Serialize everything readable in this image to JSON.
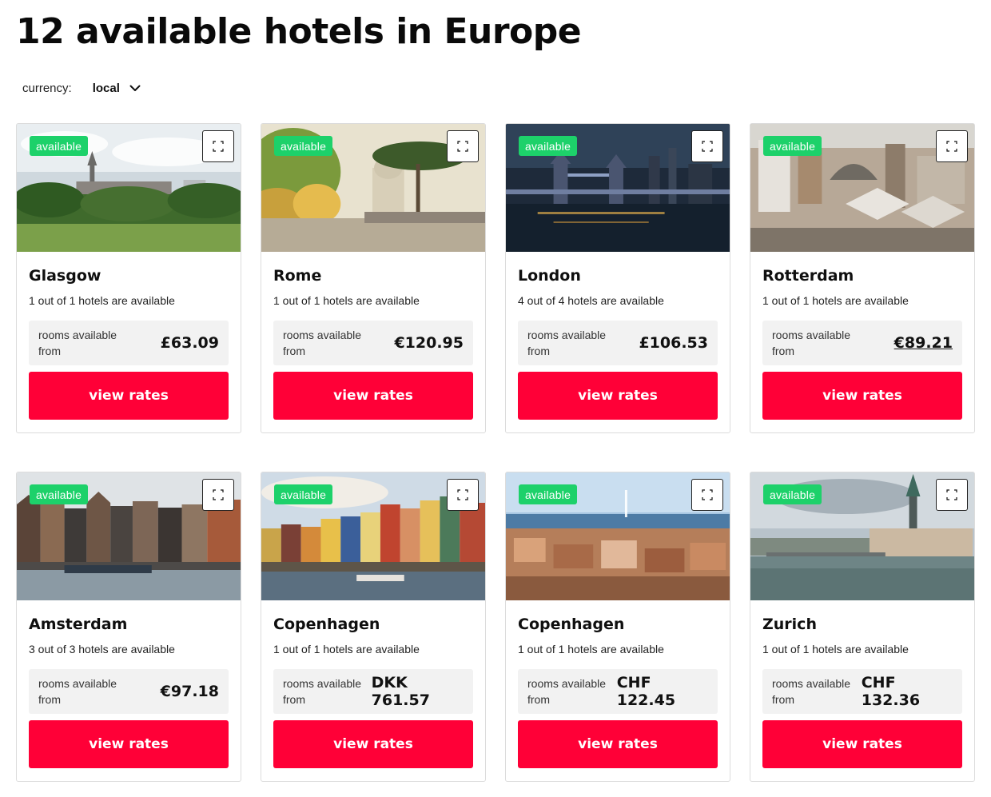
{
  "page": {
    "title": "12 available hotels in Europe"
  },
  "currency": {
    "label": "currency:",
    "value": "local"
  },
  "hotels": [
    {
      "city": "Glasgow",
      "availability": "1 out of 1 hotels are available",
      "badge": "available",
      "rooms_label": "rooms available from",
      "price": "£63.09",
      "button": "view rates",
      "image_theme": "glasgow"
    },
    {
      "city": "Rome",
      "availability": "1 out of 1 hotels are available",
      "badge": "available",
      "rooms_label": "rooms available from",
      "price": "€120.95",
      "button": "view rates",
      "image_theme": "rome"
    },
    {
      "city": "London",
      "availability": "4 out of 4 hotels are available",
      "badge": "available",
      "rooms_label": "rooms available from",
      "price": "£106.53",
      "button": "view rates",
      "image_theme": "london"
    },
    {
      "city": "Rotterdam",
      "availability": "1 out of 1 hotels are available",
      "badge": "available",
      "rooms_label": "rooms available from",
      "price": "€89.21",
      "button": "view rates",
      "image_theme": "rotterdam",
      "price_underlined": true
    },
    {
      "city": "Amsterdam",
      "availability": "3 out of 3 hotels are available",
      "badge": "available",
      "rooms_label": "rooms available from",
      "price": "€97.18",
      "button": "view rates",
      "image_theme": "amsterdam"
    },
    {
      "city": "Copenhagen",
      "availability": "1 out of 1 hotels are available",
      "badge": "available",
      "rooms_label": "rooms available from",
      "price": "DKK 761.57",
      "button": "view rates",
      "image_theme": "copenhagen"
    },
    {
      "city": "Copenhagen",
      "availability": "1 out of 1 hotels are available",
      "badge": "available",
      "rooms_label": "rooms available from",
      "price": "CHF 122.45",
      "button": "view rates",
      "image_theme": "geneva"
    },
    {
      "city": "Zurich",
      "availability": "1 out of 1 hotels are available",
      "badge": "available",
      "rooms_label": "rooms available from",
      "price": "CHF 132.36",
      "button": "view rates",
      "image_theme": "zurich"
    }
  ],
  "icons": {
    "currency_dropdown": "chevron-down-icon",
    "expand": "expand-icon"
  },
  "colors": {
    "accent": "#ff0037",
    "badge": "#1dd16a",
    "price_box": "#f2f2f2"
  }
}
